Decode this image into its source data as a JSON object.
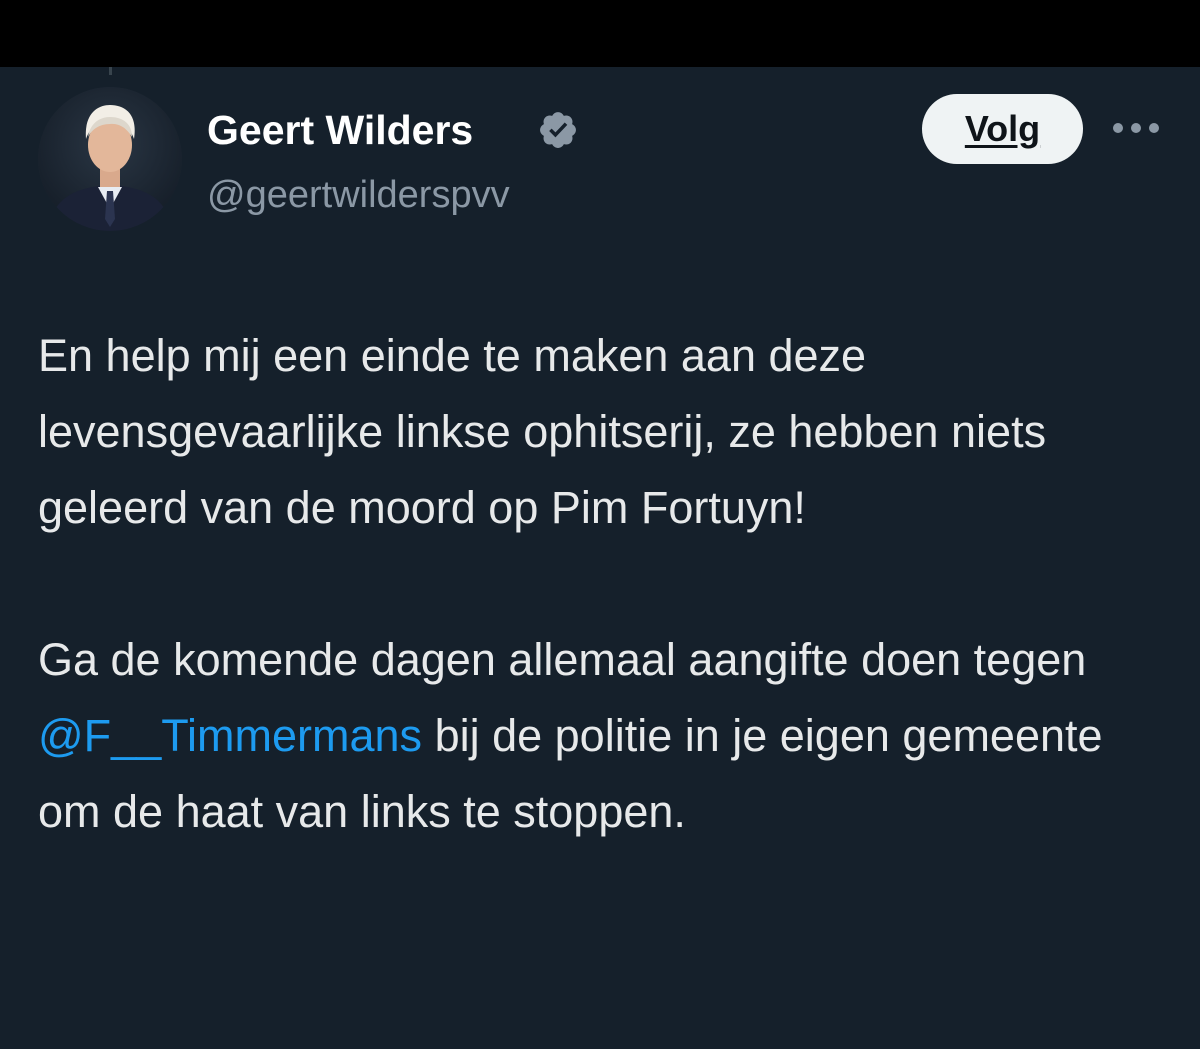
{
  "tweet": {
    "author": {
      "display_name": "Geert Wilders",
      "handle": "@geertwilderspvv",
      "verified": true,
      "verified_icon": "verified-badge-icon"
    },
    "follow_label": "Volg",
    "more_icon": "more-horizontal-icon",
    "body": {
      "paragraph_1": "En help mij een einde te maken aan deze levensgevaarlijke linkse ophitserij, ze hebben niets geleerd van de moord op Pim Fortuyn!",
      "paragraph_2_before_mention": "Ga de komende dagen allemaal aangifte doen tegen ",
      "mention": "@F__Timmermans",
      "paragraph_2_after_mention": " bij de politie in je eigen gemeente om de haat van links te stoppen."
    }
  },
  "colors": {
    "background": "#15202b",
    "text": "#e7e9ea",
    "secondary_text": "#8b98a5",
    "link": "#1d9bf0",
    "follow_button_bg": "#eff3f4"
  }
}
